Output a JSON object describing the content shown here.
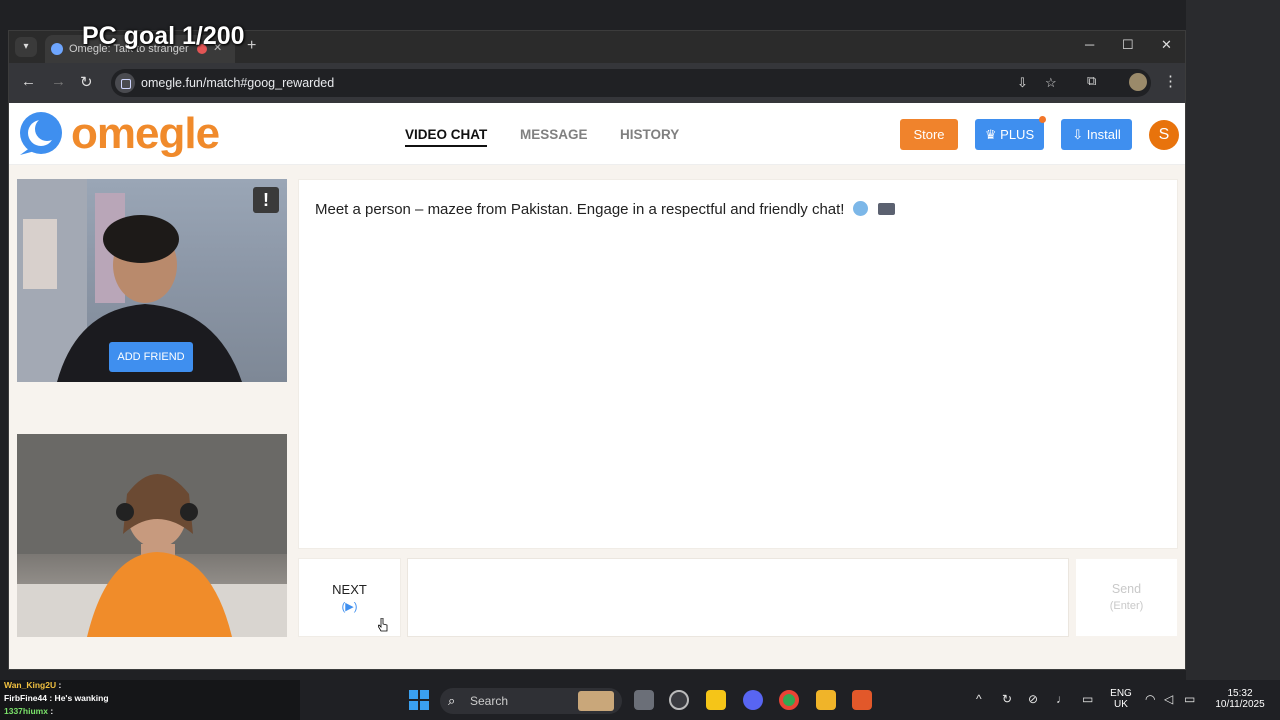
{
  "overlay": {
    "title": "PC goal 1/200"
  },
  "browser": {
    "tab_title": "Omegle: Talk to strangers w",
    "new_tab": "+",
    "url": "omegle.fun/match#goog_rewarded",
    "controls": {
      "minimize": "─",
      "maximize": "☐",
      "close": "✕"
    }
  },
  "site": {
    "logo": "omegle",
    "nav": [
      {
        "label": "VIDEO CHAT",
        "active": true
      },
      {
        "label": "MESSAGE",
        "active": false
      },
      {
        "label": "HISTORY",
        "active": false
      }
    ],
    "buttons": {
      "store": "Store",
      "plus": "PLUS",
      "install": "Install"
    },
    "user_initial": "S"
  },
  "video": {
    "report": "!",
    "add_friend": "ADD FRIEND"
  },
  "chat": {
    "message": "Meet a person – mazee from Pakistan. Engage in a respectful and friendly chat!",
    "next_label": "NEXT",
    "next_hint": "(▶)",
    "send_label": "Send",
    "send_hint": "(Enter)"
  },
  "stream_chat": [
    {
      "user": "Wan_King2U",
      "text": ":",
      "color": "#f0c040"
    },
    {
      "user": "FirbFine44",
      "text": ": He's wanking",
      "color": "#ffffff"
    },
    {
      "user": "1337hiumx",
      "text": ":",
      "color": "#7be36a"
    }
  ],
  "taskbar": {
    "search_placeholder": "Search",
    "lang_1": "ENG",
    "lang_2": "UK",
    "time": "15:32",
    "date": "10/11/2025"
  }
}
